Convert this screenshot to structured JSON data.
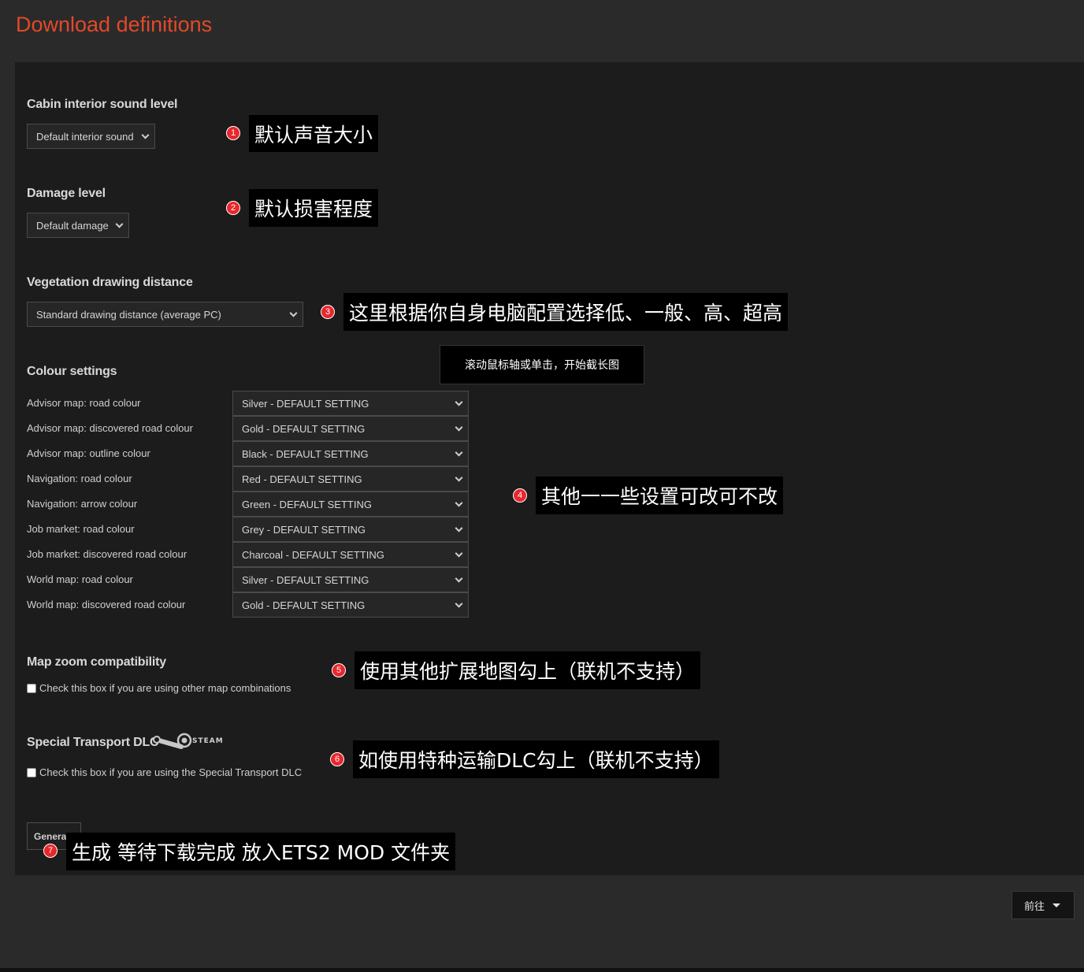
{
  "page_title": "Download definitions",
  "cabin": {
    "title": "Cabin interior sound level",
    "selected": "Default interior sound"
  },
  "damage": {
    "title": "Damage level",
    "selected": "Default damage"
  },
  "vegetation": {
    "title": "Vegetation drawing distance",
    "selected": "Standard drawing distance (average PC)"
  },
  "colour": {
    "title": "Colour settings",
    "rows": [
      {
        "label": "Advisor map: road colour",
        "value": "Silver - DEFAULT SETTING"
      },
      {
        "label": "Advisor map: discovered road colour",
        "value": "Gold - DEFAULT SETTING"
      },
      {
        "label": "Advisor map: outline colour",
        "value": "Black - DEFAULT SETTING"
      },
      {
        "label": "Navigation: road colour",
        "value": "Red - DEFAULT SETTING"
      },
      {
        "label": "Navigation: arrow colour",
        "value": "Green - DEFAULT SETTING"
      },
      {
        "label": "Job market: road colour",
        "value": "Grey - DEFAULT SETTING"
      },
      {
        "label": "Job market: discovered road colour",
        "value": "Charcoal - DEFAULT SETTING"
      },
      {
        "label": "World map: road colour",
        "value": "Silver - DEFAULT SETTING"
      },
      {
        "label": "World map: discovered road colour",
        "value": "Gold - DEFAULT SETTING"
      }
    ]
  },
  "map_zoom": {
    "title": "Map zoom compatibility",
    "checkbox_label": "Check this box if you are using other map combinations"
  },
  "special": {
    "title": "Special Transport DLC",
    "steam_text": "STEAM",
    "checkbox_label": "Check this box if you are using the Special Transport DLC"
  },
  "generate_label": "Generate",
  "goto_label": "前往",
  "tooltip": "滚动鼠标轴或单击，开始截长图",
  "annotations": [
    {
      "num": "1",
      "text": "默认声音大小"
    },
    {
      "num": "2",
      "text": "默认损害程度"
    },
    {
      "num": "3",
      "text": "这里根据你自身电脑配置选择低、一般、高、超高"
    },
    {
      "num": "4",
      "text": "其他一一些设置可改可不改"
    },
    {
      "num": "5",
      "text": "使用其他扩展地图勾上（联机不支持）"
    },
    {
      "num": "6",
      "text": "如使用特种运输DLC勾上（联机不支持）"
    },
    {
      "num": "7",
      "text": "生成 等待下载完成 放入ETS2 MOD 文件夹"
    }
  ],
  "colors": {
    "title_accent": "#e2492a",
    "annotation_badge": "#e8272d",
    "panel_bg": "#1c1c1c",
    "page_bg": "#2a2a2a"
  }
}
